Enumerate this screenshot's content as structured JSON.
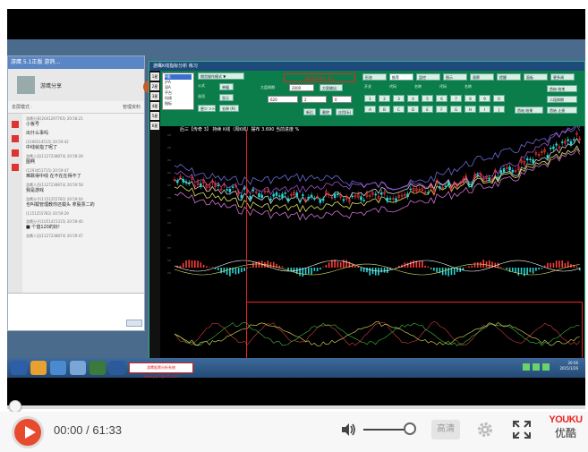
{
  "player": {
    "time_current": "00:00",
    "time_separator": " / ",
    "time_total": "61:33",
    "quality_label": "高清",
    "logo_top": "YOUKU",
    "logo_bottom": "优酷",
    "progress_fraction": 0.0,
    "volume_fraction": 0.85,
    "icons": [
      "play-icon",
      "volume-icon",
      "settings-gear-icon",
      "fullscreen-icon"
    ]
  },
  "video": {
    "watermark": "优酷",
    "top_controls": [
      "放大",
      "□",
      "□",
      "还原"
    ],
    "qq": {
      "title": "游鹰 5.1正版 游鸽…",
      "contact": "游鹰分享",
      "subtitle_left": "去屏模式 ·",
      "subtitle_right": "管理资料",
      "messages": [
        {
          "who": "游鹰分享(2041297765) 20:58:21",
          "text": "小板号"
        },
        {
          "who": "",
          "text": "出什么事吗"
        },
        {
          "who": "(2196514515) 20:59:42",
          "text": "中线就指了呢了"
        },
        {
          "who": "游鹰人员(1127238874) 20:58:28",
          "text": "图啊"
        },
        {
          "who": "(1293451715) 20:59:47",
          "text": "难跌得中线 在不在在得不了"
        },
        {
          "who": "游鹰人员(1127238874) 20:59:58",
          "text": "我是游戏"
        },
        {
          "who": "游鹰分子(1151255782) 20:59:04",
          "text": "也叫载管理教你还载头 拿股票二的"
        },
        {
          "who": "(1151255782) 20:59:29",
          "text": ""
        },
        {
          "who": "游鹰分子(1051415315) 20:59:40",
          "text": "■ 个值120的好!"
        },
        {
          "who": "游鹰人员(1127238874) 20:59:47",
          "text": ""
        }
      ]
    },
    "trade": {
      "title": "游鹰K线指标分析 练习",
      "red_hint": "请放鼠标单击 点击",
      "chart_header": "后三【传奇 3】 持续 K线（周K线）摆布 3.690 当前进度 %",
      "left_tabs": [
        "1星",
        "2星",
        "3星",
        "4星",
        "5星",
        "6星"
      ],
      "list_items": [
        "A股",
        "沪A",
        "深A",
        "平台",
        "均线",
        "指标"
      ],
      "panel_labels": [
        "期货操作模式 ▼",
        "公式",
        "单幅",
        "选项",
        "显示",
        "更少 >>",
        "名称 (R)"
      ],
      "fields": {
        "period_label": "大盘周期",
        "period_value": "2000",
        "start_value": "620",
        "v2": "2",
        "v3": "0",
        "v4": "0"
      },
      "buttons_mid": [
        "方案输出",
        "新后",
        "删除",
        "应用(&)"
      ],
      "tabs_top": [
        "形态",
        "推荐",
        "监控",
        "图示",
        "观察",
        "提醒",
        "面板",
        "更多调"
      ],
      "radio_labels": [
        "开关",
        "代码",
        "名称",
        "代码",
        "名称"
      ],
      "num_buttons": [
        "1",
        "2",
        "3",
        "4",
        "5",
        "6",
        "7",
        "8",
        "9",
        "0",
        "A",
        "B",
        "C",
        "D",
        "E",
        "F",
        "G",
        "H",
        "I",
        "J"
      ],
      "right_buttons": [
        "首始 结束",
        "二段周期",
        "首始 止损",
        "首始 结果"
      ]
    },
    "taskbar": {
      "ad_text": "游鹰股票分析系统 www.yiyingsoft.com",
      "clock_time": "20:56",
      "clock_date": "2015/1/26"
    }
  },
  "colors": {
    "accent_play": "#e84a2e",
    "panel_green": "#0b7d4a",
    "chart_red": "#dd2222"
  }
}
